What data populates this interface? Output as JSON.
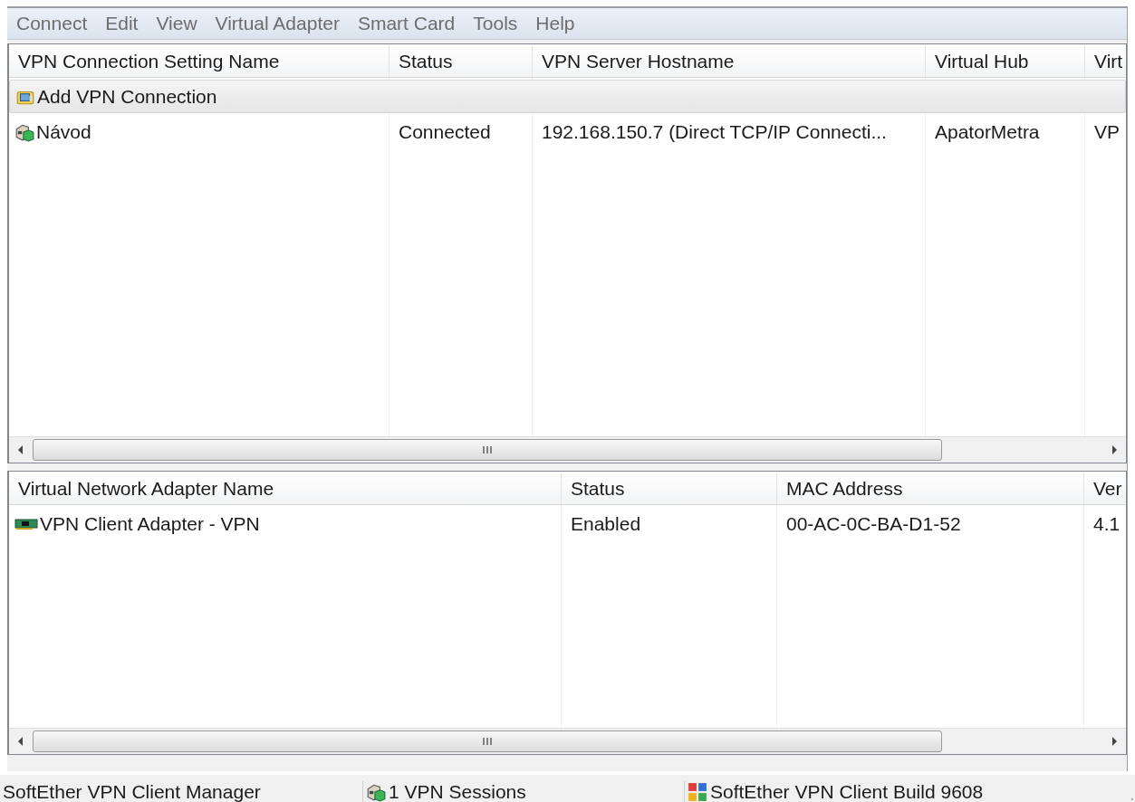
{
  "menu": [
    "Connect",
    "Edit",
    "View",
    "Virtual Adapter",
    "Smart Card",
    "Tools",
    "Help"
  ],
  "connections": {
    "columns": [
      "VPN Connection Setting Name",
      "Status",
      "VPN Server Hostname",
      "Virtual Hub",
      "Virt"
    ],
    "rows": [
      {
        "kind": "add",
        "selected": true,
        "cells": [
          "Add VPN Connection"
        ]
      },
      {
        "kind": "connection",
        "selected": false,
        "cells": [
          "Návod",
          "Connected",
          "192.168.150.7 (Direct TCP/IP Connecti...",
          "ApatorMetra",
          "VP"
        ]
      }
    ]
  },
  "adapters": {
    "columns": [
      "Virtual Network Adapter Name",
      "Status",
      "MAC Address",
      "Ver"
    ],
    "rows": [
      {
        "kind": "adapter",
        "selected": false,
        "cells": [
          "VPN Client Adapter - VPN",
          "Enabled",
          "00-AC-0C-BA-D1-52",
          "4.1"
        ]
      }
    ]
  },
  "status_bar": [
    {
      "kind": "plain",
      "text": "SoftEther VPN Client Manager"
    },
    {
      "kind": "sessions",
      "text": "1 VPN Sessions"
    },
    {
      "kind": "build",
      "text": "SoftEther VPN Client Build 9608"
    }
  ]
}
